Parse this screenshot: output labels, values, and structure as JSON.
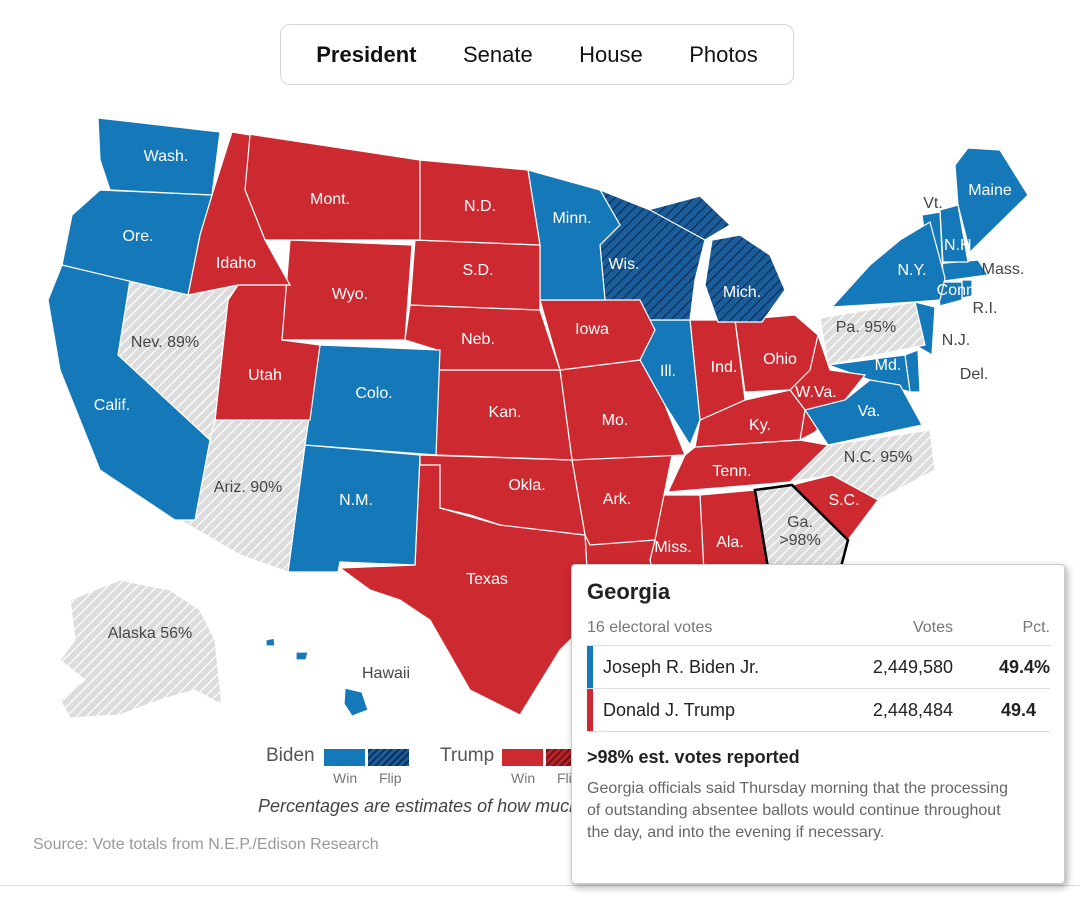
{
  "tabs": [
    {
      "label": "President",
      "active": true
    },
    {
      "label": "Senate",
      "active": false
    },
    {
      "label": "House",
      "active": false
    },
    {
      "label": "Photos",
      "active": false
    }
  ],
  "colors": {
    "biden": "#1478b9",
    "biden_flip": "#0d4a7f",
    "trump": "#cc2a30",
    "trump_flip": "#8f1a1e",
    "pending": "#dcdcdc",
    "selected_outline": "#000000"
  },
  "states": [
    {
      "abbr": "WA",
      "label": "Wash.",
      "status": "biden"
    },
    {
      "abbr": "OR",
      "label": "Ore.",
      "status": "biden"
    },
    {
      "abbr": "CA",
      "label": "Calif.",
      "status": "biden"
    },
    {
      "abbr": "ID",
      "label": "Idaho",
      "status": "trump"
    },
    {
      "abbr": "NV",
      "label": "Nev. 89%",
      "status": "pending"
    },
    {
      "abbr": "MT",
      "label": "Mont.",
      "status": "trump"
    },
    {
      "abbr": "WY",
      "label": "Wyo.",
      "status": "trump"
    },
    {
      "abbr": "UT",
      "label": "Utah",
      "status": "trump"
    },
    {
      "abbr": "CO",
      "label": "Colo.",
      "status": "biden"
    },
    {
      "abbr": "AZ",
      "label": "Ariz. 90%",
      "status": "pending"
    },
    {
      "abbr": "NM",
      "label": "N.M.",
      "status": "biden"
    },
    {
      "abbr": "ND",
      "label": "N.D.",
      "status": "trump"
    },
    {
      "abbr": "SD",
      "label": "S.D.",
      "status": "trump"
    },
    {
      "abbr": "NE",
      "label": "Neb.",
      "status": "trump"
    },
    {
      "abbr": "KS",
      "label": "Kan.",
      "status": "trump"
    },
    {
      "abbr": "OK",
      "label": "Okla.",
      "status": "trump"
    },
    {
      "abbr": "TX",
      "label": "Texas",
      "status": "trump"
    },
    {
      "abbr": "MN",
      "label": "Minn.",
      "status": "biden"
    },
    {
      "abbr": "IA",
      "label": "Iowa",
      "status": "trump"
    },
    {
      "abbr": "MO",
      "label": "Mo.",
      "status": "trump"
    },
    {
      "abbr": "AR",
      "label": "Ark.",
      "status": "trump"
    },
    {
      "abbr": "LA",
      "label": "",
      "status": "trump"
    },
    {
      "abbr": "WI",
      "label": "Wis.",
      "status": "biden_flip"
    },
    {
      "abbr": "IL",
      "label": "Ill.",
      "status": "biden"
    },
    {
      "abbr": "MI",
      "label": "Mich.",
      "status": "biden_flip"
    },
    {
      "abbr": "IN",
      "label": "Ind.",
      "status": "trump"
    },
    {
      "abbr": "OH",
      "label": "Ohio",
      "status": "trump"
    },
    {
      "abbr": "KY",
      "label": "Ky.",
      "status": "trump"
    },
    {
      "abbr": "TN",
      "label": "Tenn.",
      "status": "trump"
    },
    {
      "abbr": "MS",
      "label": "Miss.",
      "status": "trump"
    },
    {
      "abbr": "AL",
      "label": "Ala.",
      "status": "trump"
    },
    {
      "abbr": "GA",
      "label": "Ga. >98%",
      "status": "pending",
      "selected": true
    },
    {
      "abbr": "FL",
      "label": "",
      "status": "trump"
    },
    {
      "abbr": "SC",
      "label": "S.C.",
      "status": "trump"
    },
    {
      "abbr": "NC",
      "label": "N.C. 95%",
      "status": "pending"
    },
    {
      "abbr": "VA",
      "label": "Va.",
      "status": "biden"
    },
    {
      "abbr": "WV",
      "label": "W.Va.",
      "status": "trump"
    },
    {
      "abbr": "PA",
      "label": "Pa. 95%",
      "status": "pending"
    },
    {
      "abbr": "NY",
      "label": "N.Y.",
      "status": "biden"
    },
    {
      "abbr": "NJ",
      "label": "N.J.",
      "status": "biden"
    },
    {
      "abbr": "MD",
      "label": "Md.",
      "status": "biden"
    },
    {
      "abbr": "DE",
      "label": "Del.",
      "status": "biden"
    },
    {
      "abbr": "VT",
      "label": "Vt.",
      "status": "biden"
    },
    {
      "abbr": "NH",
      "label": "N.H.",
      "status": "biden"
    },
    {
      "abbr": "ME",
      "label": "Maine",
      "status": "biden"
    },
    {
      "abbr": "MA",
      "label": "Mass.",
      "status": "biden"
    },
    {
      "abbr": "CT",
      "label": "Conn.",
      "status": "biden"
    },
    {
      "abbr": "RI",
      "label": "R.I.",
      "status": "biden"
    },
    {
      "abbr": "AK",
      "label": "Alaska 56%",
      "status": "pending"
    },
    {
      "abbr": "HI",
      "label": "Hawaii",
      "status": "biden"
    }
  ],
  "legend": {
    "biden": "Biden",
    "trump": "Trump",
    "win": "Win",
    "flip": "Flip"
  },
  "note": "Percentages are estimates of how much of the vote has been counted.",
  "source": "Source: Vote totals from N.E.P./Edison Research",
  "tooltip": {
    "state": "Georgia",
    "electoral_votes": "16 electoral votes",
    "col_votes": "Votes",
    "col_pct": "Pct.",
    "candidates": [
      {
        "name": "Joseph R. Biden Jr.",
        "votes": "2,449,580",
        "pct": "49.4%",
        "party": "biden"
      },
      {
        "name": "Donald J. Trump",
        "votes": "2,448,484",
        "pct": "49.4",
        "party": "trump"
      }
    ],
    "reported": ">98% est. votes reported",
    "description": "Georgia officials said Thursday morning that the processing of outstanding absentee ballots would continue throughout the day, and into the evening if necessary."
  }
}
